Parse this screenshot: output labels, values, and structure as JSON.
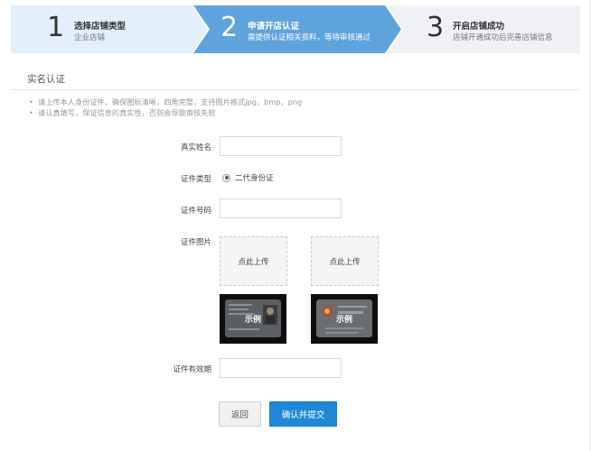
{
  "steps": [
    {
      "number": "1",
      "title": "选择店铺类型",
      "subtitle": "企业店铺",
      "state": "done"
    },
    {
      "number": "2",
      "title": "申请开店认证",
      "subtitle": "需提供认证相关资料，等待审核通过",
      "state": "active"
    },
    {
      "number": "3",
      "title": "开启店铺成功",
      "subtitle": "店铺开通成功后完善店铺信息",
      "state": "pending"
    }
  ],
  "colors": {
    "step_done": "#e3effa",
    "step_active": "#5fa3dc",
    "step_pending": "#f0f1f4",
    "primary": "#1e88d8"
  },
  "section": {
    "title": "实名认证",
    "notes": [
      "请上传本人身份证件，确保图标清晰，四角完整，支持图片格式jpg，bmp，png",
      "请认真填写，保证信息的真实性，否则会导致审核失败"
    ]
  },
  "form": {
    "real_name_label": "真实姓名",
    "real_name_value": "",
    "id_type_label": "证件类型",
    "id_type_option": "二代身份证",
    "id_number_label": "证件号码",
    "id_number_value": "",
    "id_photo_label": "证件图片",
    "upload_front": "点此上传",
    "upload_back": "点此上传",
    "sample_label": "示例",
    "valid_period_label": "证件有效期",
    "valid_period_value": ""
  },
  "actions": {
    "back": "返回",
    "submit": "确认并提交"
  }
}
